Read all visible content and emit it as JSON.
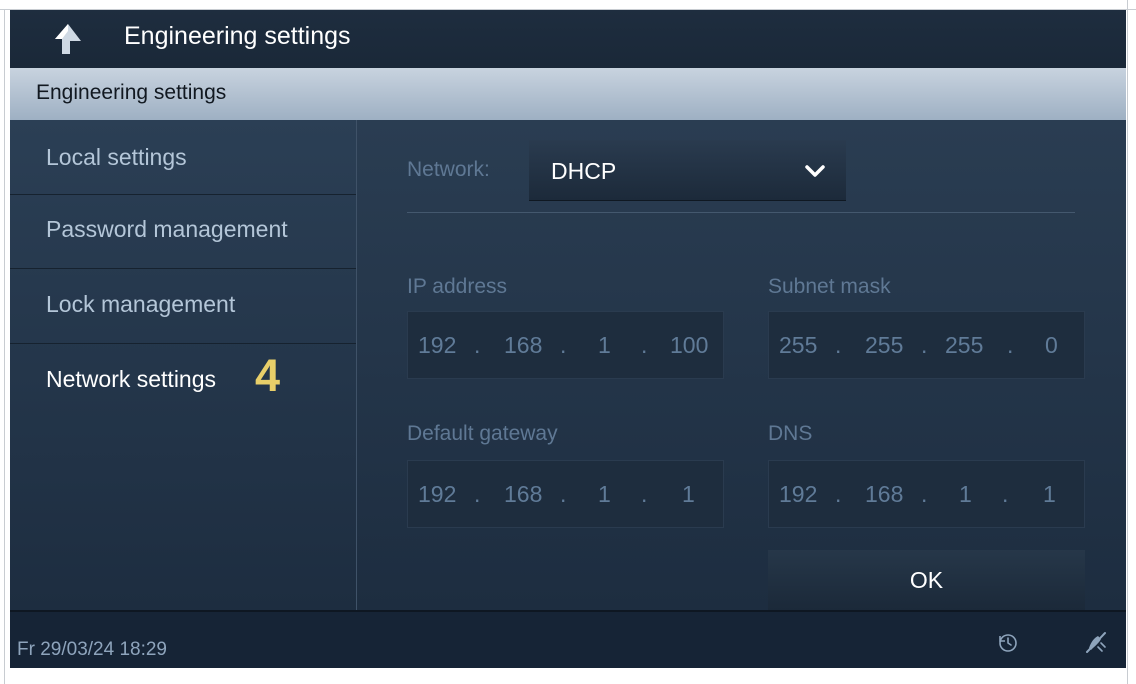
{
  "header": {
    "title": "Engineering settings",
    "back_icon": "back-arrow-icon"
  },
  "subheader": {
    "title": "Engineering settings"
  },
  "sidebar": {
    "items": [
      {
        "label": "Local settings",
        "active": false
      },
      {
        "label": "Password management",
        "active": false
      },
      {
        "label": "Lock management",
        "active": false
      },
      {
        "label": "Network settings",
        "active": true
      }
    ],
    "step_marker": "4"
  },
  "network": {
    "label": "Network:",
    "mode": "DHCP",
    "icon": "chevron-down-icon"
  },
  "fields": {
    "ip_address": {
      "label": "IP address",
      "octets": [
        "192",
        "168",
        "1",
        "100"
      ]
    },
    "subnet_mask": {
      "label": "Subnet mask",
      "octets": [
        "255",
        "255",
        "255",
        "0"
      ]
    },
    "default_gateway": {
      "label": "Default gateway",
      "octets": [
        "192",
        "168",
        "1",
        "1"
      ]
    },
    "dns": {
      "label": "DNS",
      "octets": [
        "192",
        "168",
        "1",
        "1"
      ]
    }
  },
  "ok_label": "OK",
  "status": {
    "datetime": "Fr 29/03/24  18:29",
    "icons": [
      "history-icon",
      "mute-icon"
    ]
  },
  "colors": {
    "background": "#1b2a3b",
    "subheader": "#b3c2d2",
    "text_primary": "#ffffff",
    "text_secondary": "#b4c6d8",
    "text_dim": "#5f7894",
    "marker": "#e8cf69"
  }
}
